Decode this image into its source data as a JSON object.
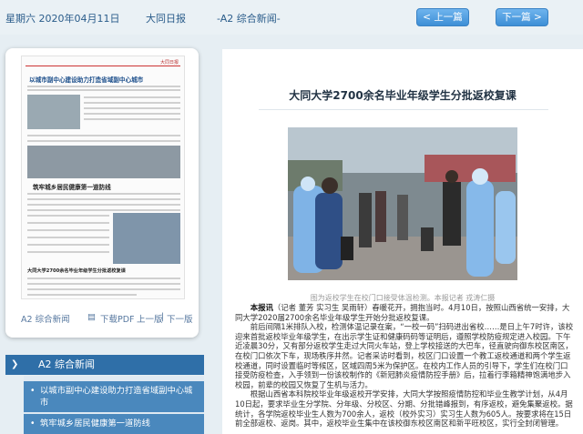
{
  "topbar": {
    "date": "星期六 2020年04月11日",
    "paper_name": "大同日报",
    "page_label": "-A2 综合新闻-",
    "prev_button": "上一篇",
    "next_button": "下一篇",
    "prev_icon": "chevron-left-icon",
    "next_icon": "chevron-right-icon"
  },
  "thumbnail": {
    "masthead": "大同日报",
    "headline_1": "以城市副中心建设助力打造省域副中心城市",
    "headline_2": "筑牢城乡居民健康第一道防线",
    "headline_3": "大同大学2700余名毕业年级学生分批返校复课",
    "page_label": "A2 综合新闻",
    "pdf_link": "下载PDF",
    "prev_page": "上一版",
    "next_page": "下一版",
    "pdf_icon": "document-icon"
  },
  "section": {
    "label": "A2  综合新闻",
    "arrow_icon": "chevron-right-icon",
    "items": [
      {
        "label": "以城市副中心建设助力打造省域副中心城市"
      },
      {
        "label": "筑牢城乡居民健康第一道防线"
      }
    ]
  },
  "article": {
    "title": "大同大学2700余名毕业年级学生分批返校复课",
    "photo_caption": "图为返校学生在校门口接受体温检测。本报记者 戎涛仁摄",
    "lead_byline": "本报讯",
    "paragraph_1": "（记者 董芳 实习生 吴雨轩）春暖花开，拥抱当时。4月10日，按照山西省统一安排，大同大学2020届2700余名毕业年级学生开始分批返校复课。",
    "paragraph_2": "前后间隔1米排队入校，检测体温记录在案，“一校一码”扫码进出省校……是日上午7时许，该校迎来首批返校毕业年级学生，在出示学生证和健康码码等证明后，遵照学校防疫规定进入校园。下午近凌晨30分，又有部分返校学生走过大同火车站，登上学校接送的大巴车，径直驶向御东校区南区，在校门口依次下车，现场秩序井然。记者采访时看到，校区门口设置一个教工返校通道和两个学生返校通道，同时设置临时等候区，区域四周5米为保护区。在校内工作人员的引导下，学生们在校门口接受防疫检查，入手领到一份该校制作的《新冠肺炎疫情防控手册》后，拉着行李箱精神饱满地步入校园，前辈的校园又恢复了生机与活力。",
    "paragraph_3": "根据山西省本科院校毕业年级返校开学安排，大同大学按照疫情防控和毕业生教学计划，从4月10日起，要求毕业生分学院、分年级、分校区、分期、分批错峰报到，有序返校，避免集聚返校。据统计，各学院返校毕业生人数为700余人，返校（校外实习）实习生人数为605人。按要求将在15日前全部返校、返岗。其中，返校毕业生集中在该校御东校区南区和新平旺校区，实行全封闭管理。"
  }
}
